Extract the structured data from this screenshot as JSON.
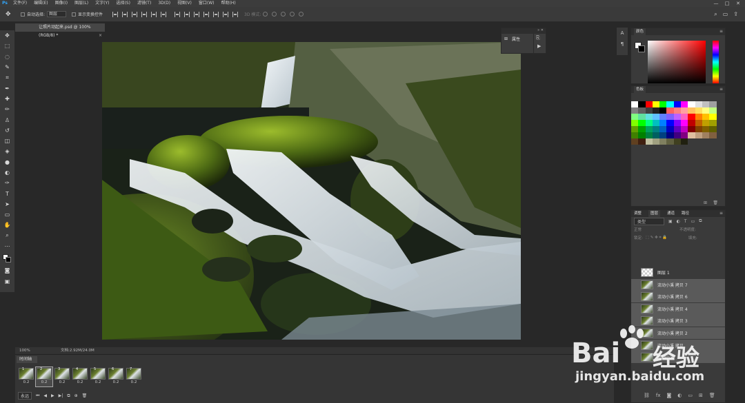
{
  "menubar": {
    "logo": "Ps",
    "items": [
      "文件(F)",
      "编辑(E)",
      "图像(I)",
      "图层(L)",
      "文字(Y)",
      "选择(S)",
      "滤镜(T)",
      "3D(D)",
      "视图(V)",
      "窗口(W)",
      "帮助(H)"
    ],
    "minimize": "—",
    "maximize": "□",
    "close": "✕"
  },
  "optionsbar": {
    "auto_select": "自动选择:",
    "auto_select_value": "图层",
    "show_transform": "显示变换控件",
    "mode3d": "3D 模式:"
  },
  "document": {
    "tab_title": "让照片动起来.psd @ 100%(RGB/8) *",
    "tab_close": "×"
  },
  "mini_panel": {
    "properties_label": "属性"
  },
  "statusbar": {
    "zoom": "100%",
    "doc_info": "文档:2.92M/24.0M"
  },
  "timeline": {
    "tab_label": "时间轴",
    "frames": [
      {
        "num": "1",
        "duration": "0.2"
      },
      {
        "num": "2",
        "duration": "0.2"
      },
      {
        "num": "3",
        "duration": "0.2"
      },
      {
        "num": "4",
        "duration": "0.2"
      },
      {
        "num": "5",
        "duration": "0.2"
      },
      {
        "num": "6",
        "duration": "0.2"
      },
      {
        "num": "7",
        "duration": "0.2"
      }
    ],
    "loop_label": "永远"
  },
  "color_panel": {
    "tab": "颜色"
  },
  "swatch_panel": {
    "tab": "色板",
    "colors": [
      "#ffffff",
      "#000000",
      "#ff0000",
      "#ffff00",
      "#00ff00",
      "#00ffff",
      "#0000ff",
      "#ff00ff",
      "#ffffff",
      "#e0e0e0",
      "#c0c0c0",
      "#a0a0a0",
      "#808080",
      "#606060",
      "#404040",
      "#202020",
      "#000000",
      "#ff6060",
      "#ff8080",
      "#ffa0a0",
      "#ffc060",
      "#ffe060",
      "#ffff80",
      "#c0ff80",
      "#80ff80",
      "#60e0a0",
      "#60e0e0",
      "#60c0ff",
      "#6080ff",
      "#8060ff",
      "#c060ff",
      "#ff60c0",
      "#ff0000",
      "#ff8000",
      "#ffc000",
      "#ffff00",
      "#80ff00",
      "#00ff00",
      "#00ff80",
      "#00c0c0",
      "#0080ff",
      "#0000ff",
      "#8000ff",
      "#ff00ff",
      "#c00000",
      "#c06000",
      "#c0a000",
      "#a0a000",
      "#60a000",
      "#00a000",
      "#00a060",
      "#008080",
      "#0060c0",
      "#0000c0",
      "#6000c0",
      "#c000c0",
      "#800000",
      "#804000",
      "#806000",
      "#606000",
      "#408000",
      "#008000",
      "#008040",
      "#006060",
      "#004080",
      "#000080",
      "#400080",
      "#800080",
      "#e0c0a0",
      "#c0a080",
      "#a08060",
      "#806040",
      "#604020",
      "#402010",
      "#c0c0a0",
      "#a0a080",
      "#808060",
      "#606040",
      "#404020",
      "#202010"
    ]
  },
  "layers_panel": {
    "tabs": [
      "调整",
      "图层",
      "通道",
      "路径"
    ],
    "active_tab": "图层",
    "kind": "类型",
    "blend_mode": "正常",
    "opacity_label": "不透明度:",
    "lock_label": "锁定:",
    "fill_label": "填充:",
    "layers": [
      {
        "name": "图层 1",
        "thumb": "empty",
        "selected": false
      },
      {
        "name": "流动小溪 拷贝 7",
        "thumb": "photo",
        "selected": true
      },
      {
        "name": "流动小溪 拷贝 6",
        "thumb": "photo",
        "selected": true
      },
      {
        "name": "流动小溪 拷贝 4",
        "thumb": "photo",
        "selected": true
      },
      {
        "name": "流动小溪 拷贝 3",
        "thumb": "photo",
        "selected": true
      },
      {
        "name": "流动小溪 拷贝 2",
        "thumb": "photo",
        "selected": true
      },
      {
        "name": "流动小溪 拷贝",
        "thumb": "photo",
        "selected": true
      },
      {
        "name": "流动小溪",
        "thumb": "photo",
        "selected": true
      }
    ]
  },
  "watermark": {
    "brand_left": "Bai",
    "brand_right": "经验",
    "url": "jingyan.baidu.com"
  }
}
